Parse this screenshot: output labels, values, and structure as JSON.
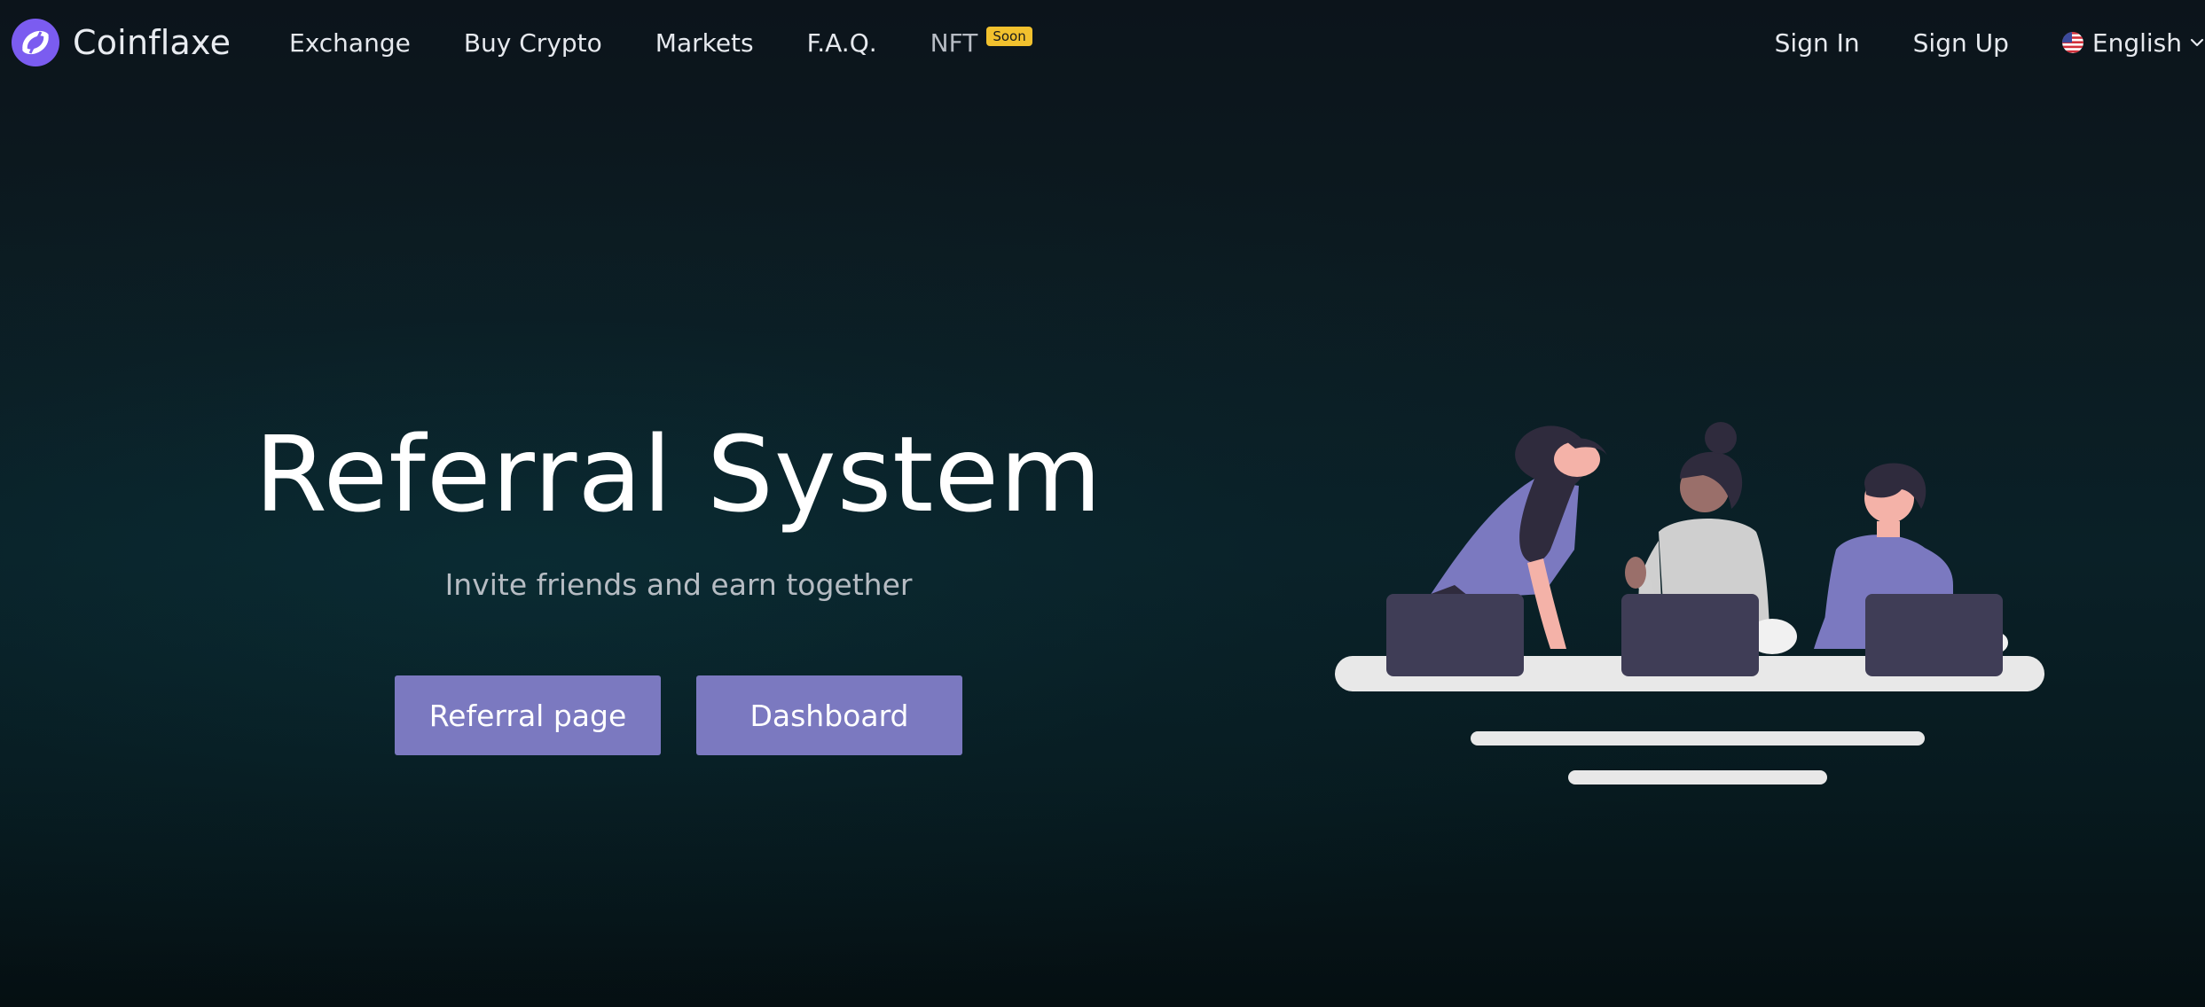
{
  "header": {
    "brand": "Coinflaxe",
    "logo_icon": "coinflaxe-logo-icon",
    "nav": [
      {
        "label": "Exchange"
      },
      {
        "label": "Buy Crypto"
      },
      {
        "label": "Markets"
      },
      {
        "label": "F.A.Q."
      },
      {
        "label": "NFT",
        "badge": "Soon"
      }
    ],
    "sign_in": "Sign In",
    "sign_up": "Sign Up",
    "language": "English",
    "language_flag_icon": "us-flag-icon",
    "language_chevron_icon": "chevron-down-icon"
  },
  "hero": {
    "title": "Referral System",
    "subtitle": "Invite friends and earn together",
    "referral_button": "Referral page",
    "dashboard_button": "Dashboard",
    "illustration_icon": "people-at-laptops-illustration"
  },
  "colors": {
    "accent": "#7b79c0",
    "badge": "#f2c12e",
    "logo": "#7b5cf0"
  }
}
